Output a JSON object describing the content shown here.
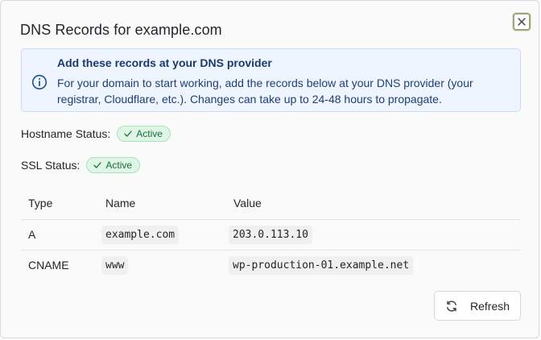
{
  "dialog": {
    "title": "DNS Records for example.com"
  },
  "info": {
    "heading": "Add these records at your DNS provider",
    "body": "For your domain to start working, add the records below at your DNS provider (your registrar, Cloudflare, etc.). Changes can take up to 24-48 hours to propagate."
  },
  "status": {
    "hostname_label": "Hostname Status:",
    "hostname_value": "Active",
    "ssl_label": "SSL Status:",
    "ssl_value": "Active"
  },
  "table": {
    "headers": [
      "Type",
      "Name",
      "Value"
    ],
    "rows": [
      [
        "A",
        "example.com",
        "203.0.113.10"
      ],
      [
        "CNAME",
        "www",
        "wp-production-01.example.net"
      ]
    ]
  },
  "actions": {
    "refresh_label": "Refresh"
  },
  "colors": {
    "info_bg": "#eef5ff",
    "badge_bg": "#dff6e6",
    "badge_text": "#1d6b38",
    "info_text": "#1d3f73"
  }
}
